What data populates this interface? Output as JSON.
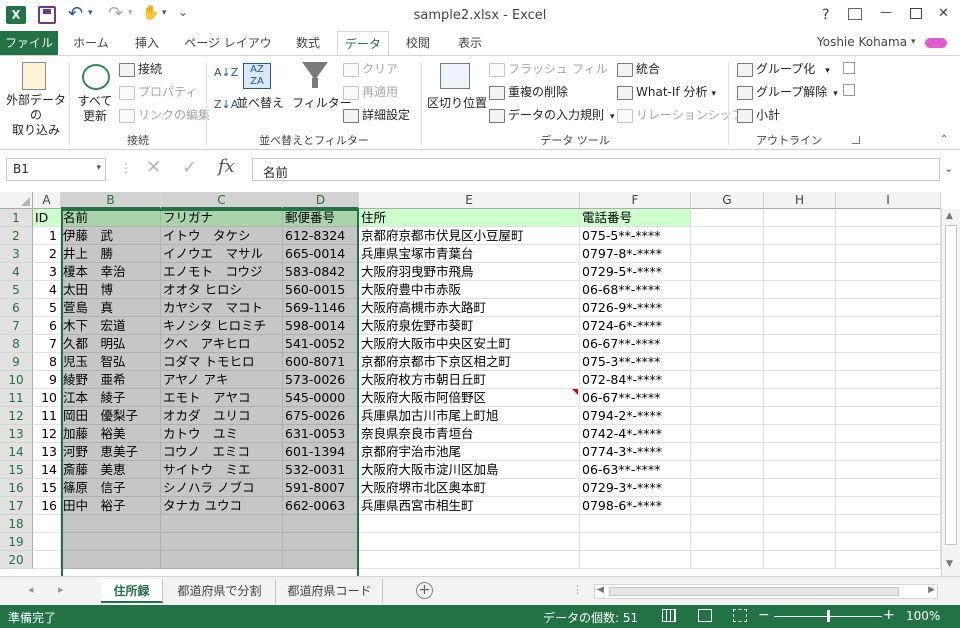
{
  "title": {
    "text": "sample2.xlsx - Excel",
    "help": "?",
    "restore": "🗗",
    "min": "—",
    "max": "☐",
    "close": "✕"
  },
  "qat": {
    "excel": "X",
    "save": "💾",
    "undo": "↶",
    "redo": "↷",
    "touch": "✋",
    "more": "⌄"
  },
  "tabs": {
    "file": "ファイル",
    "home": "ホーム",
    "insert": "挿入",
    "layout": "ページ レイアウト",
    "formulas": "数式",
    "data": "データ",
    "review": "校閲",
    "view": "表示",
    "user": "Yoshie Kohama"
  },
  "ribbon": {
    "ext_data": "外部データの\n取り込み",
    "refresh_all": "すべて\n更新",
    "connections": "接続",
    "properties": "プロパティ",
    "edit_links": "リンクの編集",
    "g_connections": "接続",
    "sort_az": "A↓Z",
    "sort_za": "Z↓A",
    "sort": "並べ替え",
    "filter": "フィルター",
    "clear": "クリア",
    "reapply": "再適用",
    "advanced": "詳細設定",
    "g_sortfilter": "並べ替えとフィルター",
    "text_to_cols": "区切り位置",
    "flash_fill": "フラッシュ フィル",
    "remove_dup": "重複の削除",
    "validation": "データの入力規則",
    "consolidate": "統合",
    "whatif": "What-If 分析",
    "relationships": "リレーションシップ",
    "g_datatools": "データ ツール",
    "group": "グループ化",
    "ungroup": "グループ解除",
    "subtotal": "小計",
    "g_outline": "アウトライン"
  },
  "formula_bar": {
    "name_box": "B1",
    "content": "名前"
  },
  "columns": [
    "A",
    "B",
    "C",
    "D",
    "E",
    "F",
    "G",
    "H",
    "I"
  ],
  "rows": [
    "1",
    "2",
    "3",
    "4",
    "5",
    "6",
    "7",
    "8",
    "9",
    "10",
    "11",
    "12",
    "13",
    "14",
    "15",
    "16",
    "17",
    "18",
    "19",
    "20"
  ],
  "table": {
    "header": [
      "ID",
      "名前",
      "フリガナ",
      "郵便番号",
      "住所",
      "電話番号"
    ],
    "data": [
      [
        "1",
        "伊藤　武",
        "イトウ　タケシ",
        "612-8324",
        "京都府京都市伏見区小豆屋町",
        "075-5**-****"
      ],
      [
        "2",
        "井上　勝",
        "イノウエ　マサル",
        "665-0014",
        "兵庫県宝塚市青葉台",
        "0797-8*-****"
      ],
      [
        "3",
        "榎本　幸治",
        "エノモト　コウジ",
        "583-0842",
        "大阪府羽曳野市飛鳥",
        "0729-5*-****"
      ],
      [
        "4",
        "太田　博",
        "オオタ ヒロシ",
        "560-0015",
        "大阪府豊中市赤阪",
        "06-68**-****"
      ],
      [
        "5",
        "萱島　真",
        "カヤシマ　マコト",
        "569-1146",
        "大阪府高槻市赤大路町",
        "0726-9*-****"
      ],
      [
        "6",
        "木下　宏道",
        "キノシタ ヒロミチ",
        "598-0014",
        "大阪府泉佐野市葵町",
        "0724-6*-****"
      ],
      [
        "7",
        "久都　明弘",
        "クベ　アキヒロ",
        "541-0052",
        "大阪府大阪市中央区安土町",
        "06-67**-****"
      ],
      [
        "8",
        "児玉　智弘",
        "コダマ トモヒロ",
        "600-8071",
        "京都府京都市下京区相之町",
        "075-3**-****"
      ],
      [
        "9",
        "綾野　亜希",
        "アヤノ アキ",
        "573-0026",
        "大阪府枚方市朝日丘町",
        "072-84*-****"
      ],
      [
        "10",
        "江本　綾子",
        "エモト　アヤコ",
        "545-0000",
        "大阪府大阪市阿倍野区",
        "06-67**-****"
      ],
      [
        "11",
        "岡田　優梨子",
        "オカダ　ユリコ",
        "675-0026",
        "兵庫県加古川市尾上町旭",
        "0794-2*-****"
      ],
      [
        "12",
        "加藤　裕美",
        "カトウ　ユミ",
        "631-0053",
        "奈良県奈良市青垣台",
        "0742-4*-****"
      ],
      [
        "13",
        "河野　恵美子",
        "コウノ　エミコ",
        "601-1394",
        "京都府宇治市池尾",
        "0774-3*-****"
      ],
      [
        "14",
        "斎藤　美恵",
        "サイトウ　ミエ",
        "532-0031",
        "大阪府大阪市淀川区加島",
        "06-63**-****"
      ],
      [
        "15",
        "篠原　信子",
        "シノハラ ノブコ",
        "591-8007",
        "大阪府堺市北区奥本町",
        "0729-3*-****"
      ],
      [
        "16",
        "田中　裕子",
        "タナカ ユウコ",
        "662-0063",
        "兵庫県西宮市相生町",
        "0798-6*-****"
      ]
    ]
  },
  "sheets": [
    "住所録",
    "都道府県で分割",
    "都道府県コード"
  ],
  "status": {
    "ready": "準備完了",
    "count": "データの個数: 51",
    "zoom": "100%",
    "minus": "−",
    "plus": "+"
  },
  "colors": {
    "accent": "#217346",
    "header_fill": "#ccffcc"
  }
}
